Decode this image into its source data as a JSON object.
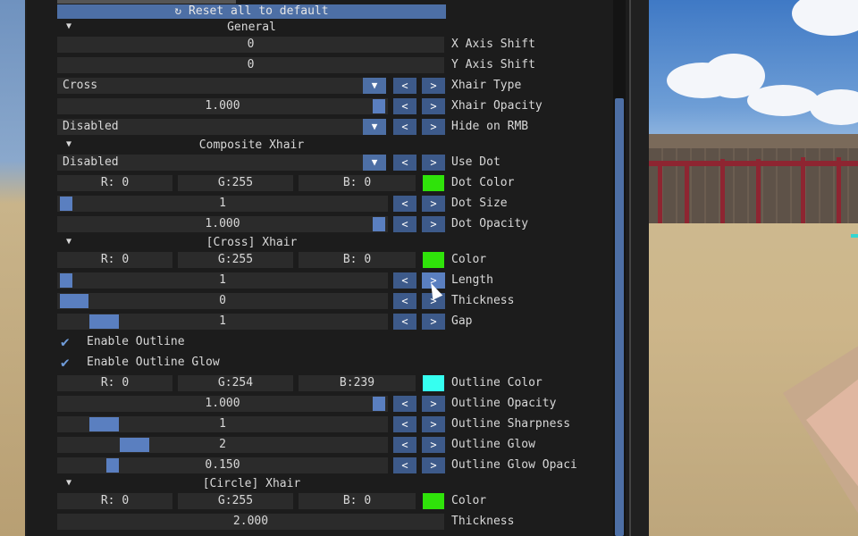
{
  "colors": {
    "accent": "#4d6fa5",
    "green": "#2fe30a",
    "cyan": "#36fff0",
    "panel": "#1c1c1c",
    "field": "#2b2b2b"
  },
  "reset_label": "Reset all to default",
  "sections": {
    "general": "General",
    "composite": "Composite Xhair",
    "cross": "[Cross] Xhair",
    "circle": "[Circle] Xhair"
  },
  "general": {
    "x_shift": "0",
    "x_shift_label": "X Axis Shift",
    "y_shift": "0",
    "y_shift_label": "Y Axis Shift",
    "type_value": "Cross",
    "type_label": "Xhair Type",
    "opacity_value": "1.000",
    "opacity_label": "Xhair Opacity",
    "opacity_level": 1.0,
    "hide_value": "Disabled",
    "hide_label": "Hide on RMB"
  },
  "composite": {
    "use_dot_value": "Disabled",
    "use_dot_label": "Use Dot",
    "dot_r": "R:  0",
    "dot_g": "G:255",
    "dot_b": "B:  0",
    "dot_color_label": "Dot Color",
    "dot_size": "1",
    "dot_size_label": "Dot Size",
    "dot_opacity": "1.000",
    "dot_opacity_label": "Dot Opacity"
  },
  "cross": {
    "r": "R:  0",
    "g": "G:255",
    "b": "B:  0",
    "color_label": "Color",
    "length": "1",
    "length_label": "Length",
    "thickness": "0",
    "thickness_label": "Thickness",
    "gap": "1",
    "gap_label": "Gap",
    "enable_outline": "Enable Outline",
    "enable_outline_glow": "Enable Outline Glow",
    "o_r": "R:  0",
    "o_g": "G:254",
    "o_b": "B:239",
    "outline_color_label": "Outline Color",
    "outline_opacity": "1.000",
    "outline_opacity_label": "Outline Opacity",
    "outline_sharpness": "1",
    "outline_sharpness_label": "Outline Sharpness",
    "outline_glow": "2",
    "outline_glow_label": "Outline Glow",
    "outline_glow_opacity": "0.150",
    "outline_glow_opacity_label": "Outline Glow Opaci"
  },
  "circle": {
    "r": "R:  0",
    "g": "G:255",
    "b": "B:  0",
    "color_label": "Color",
    "thickness": "2.000",
    "thickness_label": "Thickness"
  },
  "icons": {
    "reset": "↻",
    "collapse": "▼",
    "combo": "▼",
    "left": "<",
    "right": ">",
    "check": "✔"
  }
}
